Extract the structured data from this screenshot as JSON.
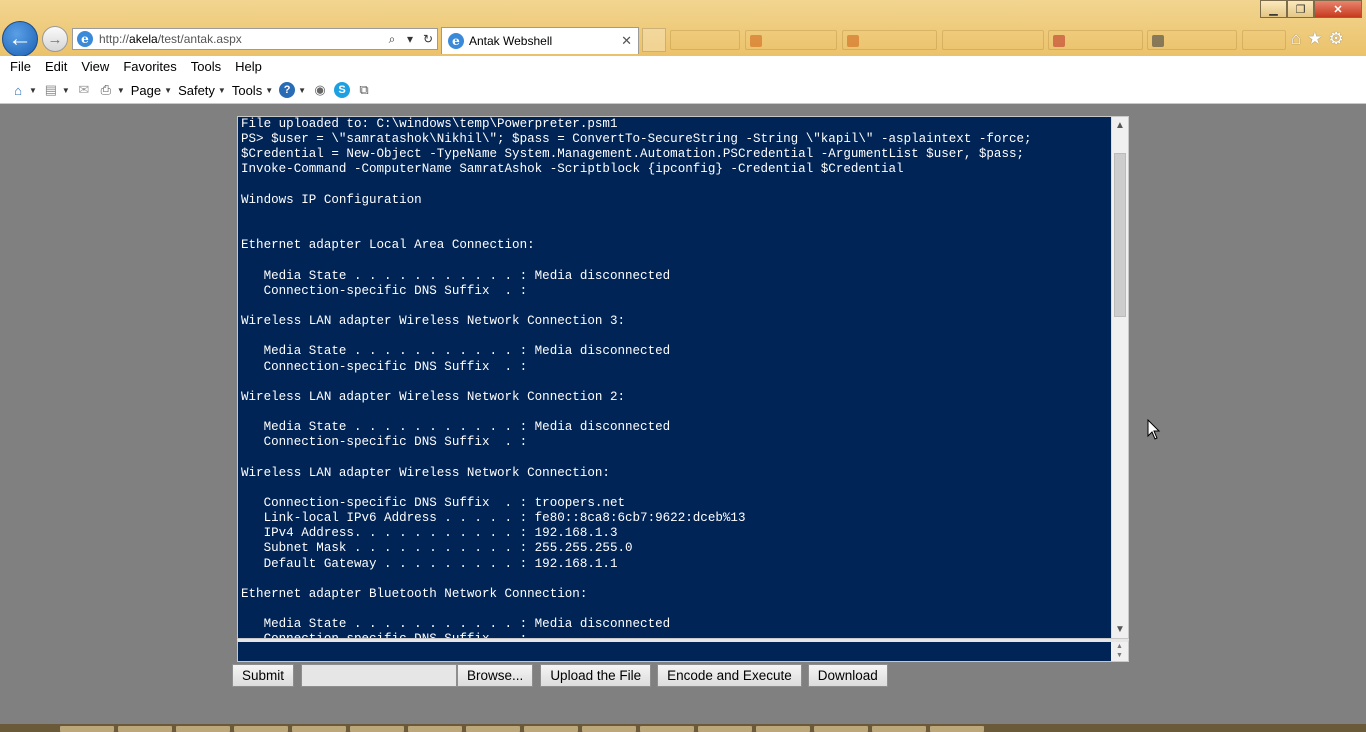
{
  "browser": {
    "url_prefix": "http://",
    "url_domain": "akela",
    "url_path": "/test/antak.aspx",
    "active_tab_title": "Antak Webshell"
  },
  "menu": [
    "File",
    "Edit",
    "View",
    "Favorites",
    "Tools",
    "Help"
  ],
  "command_bar": {
    "page_label": "Page",
    "safety_label": "Safety",
    "tools_label": "Tools"
  },
  "console": {
    "output": "File uploaded to: C:\\windows\\temp\\Powerpreter.psm1\nPS> $user = \\\"samratashok\\Nikhil\\\"; $pass = ConvertTo-SecureString -String \\\"kapil\\\" -asplaintext -force;\n$Credential = New-Object -TypeName System.Management.Automation.PSCredential -ArgumentList $user, $pass;\nInvoke-Command -ComputerName SamratAshok -Scriptblock {ipconfig} -Credential $Credential\n\nWindows IP Configuration\n\n\nEthernet adapter Local Area Connection:\n\n   Media State . . . . . . . . . . . : Media disconnected\n   Connection-specific DNS Suffix  . :\n\nWireless LAN adapter Wireless Network Connection 3:\n\n   Media State . . . . . . . . . . . : Media disconnected\n   Connection-specific DNS Suffix  . :\n\nWireless LAN adapter Wireless Network Connection 2:\n\n   Media State . . . . . . . . . . . : Media disconnected\n   Connection-specific DNS Suffix  . :\n\nWireless LAN adapter Wireless Network Connection:\n\n   Connection-specific DNS Suffix  . : troopers.net\n   Link-local IPv6 Address . . . . . : fe80::8ca8:6cb7:9622:dceb%13\n   IPv4 Address. . . . . . . . . . . : 192.168.1.3\n   Subnet Mask . . . . . . . . . . . : 255.255.255.0\n   Default Gateway . . . . . . . . . : 192.168.1.1\n\nEthernet adapter Bluetooth Network Connection:\n\n   Media State . . . . . . . . . . . : Media disconnected\n   Connection-specific DNS Suffix  . :",
    "command_value": ""
  },
  "buttons": {
    "submit": "Submit",
    "browse": "Browse...",
    "upload": "Upload the File",
    "encode_execute": "Encode and Execute",
    "download": "Download"
  },
  "colors": {
    "console_bg": "#012456",
    "console_text": "#ffffff",
    "page_bg": "#808080"
  }
}
